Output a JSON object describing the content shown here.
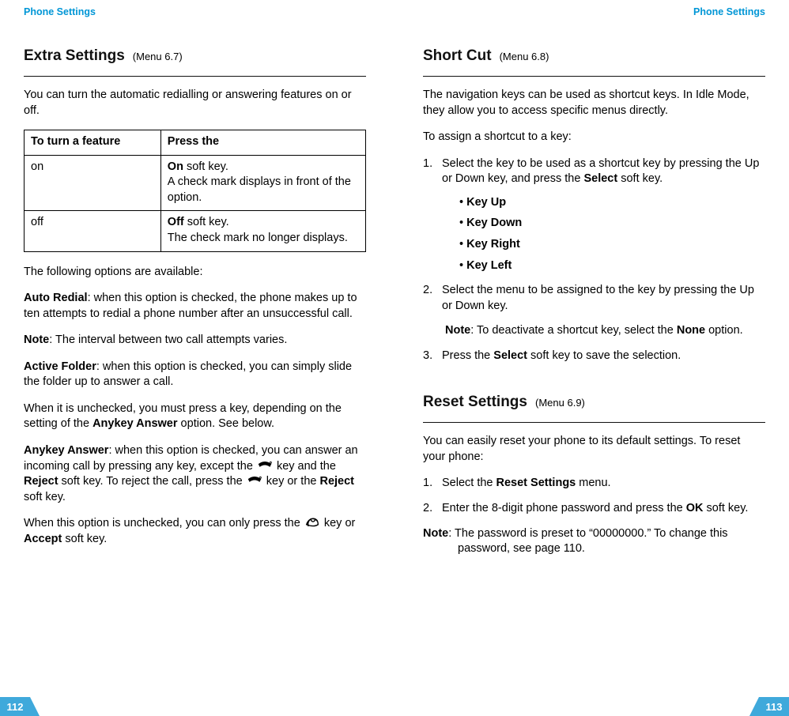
{
  "left": {
    "running_head": "Phone Settings",
    "page_num": "112",
    "heading": {
      "title": "Extra Settings",
      "menu": "(Menu 6.7)"
    },
    "intro": "You can turn the automatic redialling or answering features on or off.",
    "table": {
      "h1": "To turn a feature",
      "h2": "Press the",
      "r1c1": "on",
      "r1c2a": "On",
      "r1c2b": " soft key.",
      "r1c2c": "A check mark displays in front of the option.",
      "r2c1": "off",
      "r2c2a": "Off",
      "r2c2b": " soft key.",
      "r2c2c": "The check mark no longer displays."
    },
    "avail": "The following options are available:",
    "auto_redial_b": "Auto Redial",
    "auto_redial_t": ": when this option is checked, the phone makes up to ten attempts to redial a phone number after an unsuccessful call.",
    "note1_b": "Note",
    "note1_t": ": The interval between two call attempts varies.",
    "active_folder_b": "Active Folder",
    "active_folder_t": ": when this option is checked, you can simply slide the folder up to answer a call.",
    "active_folder_p2a": "When it is unchecked, you must press a key, depending on the setting of the ",
    "active_folder_p2b": "Anykey Answer",
    "active_folder_p2c": " option. See below.",
    "anykey_b": "Anykey Answer",
    "anykey_t1": ": when this option is checked, you can answer an incoming call by pressing any key, except the ",
    "anykey_t2": " key and the ",
    "anykey_t3": "Reject",
    "anykey_t4": " soft key. To reject the call, press the ",
    "anykey_t5": " key or the ",
    "anykey_t6": "Reject",
    "anykey_t7": " soft key.",
    "anykey_p2a": "When this option is unchecked, you can only press the ",
    "anykey_p2b": " key or ",
    "anykey_p2c": "Accept",
    "anykey_p2d": " soft key."
  },
  "right": {
    "running_head": "Phone Settings",
    "page_num": "113",
    "h1": {
      "title": "Short Cut",
      "menu": "(Menu 6.8)"
    },
    "sc_intro": "The navigation keys can be used as shortcut keys. In Idle Mode, they allow you to access specific menus directly.",
    "sc_assign": "To assign a shortcut to a key:",
    "s1n": "1.",
    "s1a": "Select the key to be used as a shortcut key by pressing the Up or Down key, and press the ",
    "s1b": "Select",
    "s1c": " soft key.",
    "k1": "Key Up",
    "k2": "Key Down",
    "k3": "Key Right",
    "k4": "Key Left",
    "s2n": "2.",
    "s2": "Select the menu to be assigned to the key by pressing the Up or Down key.",
    "s2note_b": "Note",
    "s2note_t1": ": To deactivate a shortcut key, select the ",
    "s2note_t2": "None",
    "s2note_t3": " option.",
    "s3n": "3.",
    "s3a": "Press the ",
    "s3b": "Select",
    "s3c": " soft key to save the selection.",
    "h2": {
      "title": "Reset Settings",
      "menu": "(Menu 6.9)"
    },
    "rs_intro": "You can easily reset your phone to its default settings. To reset your phone:",
    "rs1n": "1.",
    "rs1a": "Select the ",
    "rs1b": "Reset Settings",
    "rs1c": " menu.",
    "rs2n": "2.",
    "rs2a": "Enter the 8-digit phone password and press the ",
    "rs2b": "OK",
    "rs2c": " soft key.",
    "rsnote_b": "Note",
    "rsnote_t": ": The password is preset to “00000000.” To change this password, see page 110."
  }
}
